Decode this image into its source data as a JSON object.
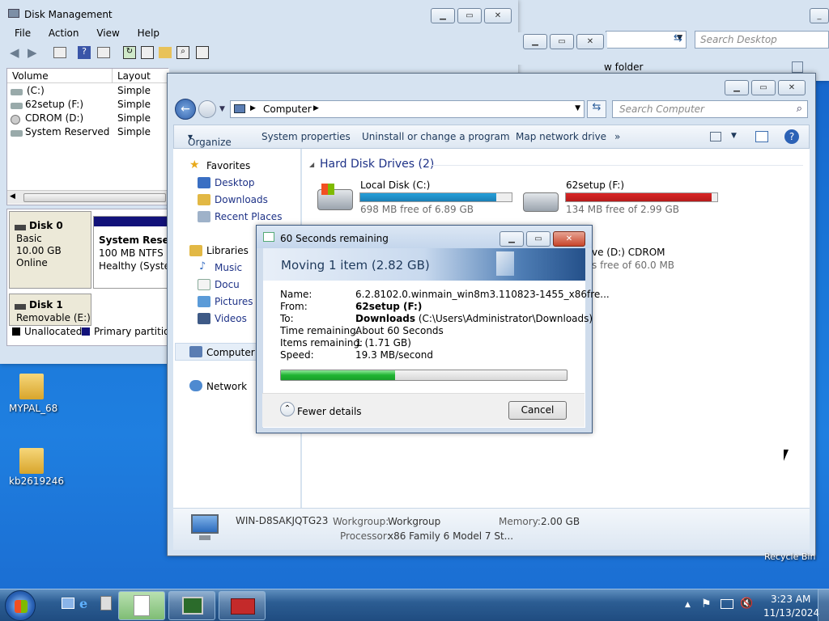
{
  "disk_mgmt": {
    "title": "Disk Management",
    "menu": [
      "File",
      "Action",
      "View",
      "Help"
    ],
    "col_volume": "Volume",
    "col_layout": "Layout",
    "volumes": [
      {
        "name": "(C:)",
        "layout": "Simple"
      },
      {
        "name": "62setup (F:)",
        "layout": "Simple"
      },
      {
        "name": "CDROM (D:)",
        "layout": "Simple"
      },
      {
        "name": "System Reserved",
        "layout": "Simple"
      }
    ],
    "disk0": {
      "name": "Disk 0",
      "type": "Basic",
      "size": "10.00 GB",
      "status": "Online"
    },
    "sysres": {
      "name": "System Reserv",
      "size": "100 MB NTFS",
      "status": "Healthy (System"
    },
    "disk1": {
      "name": "Disk 1",
      "type": "Removable (E:)"
    },
    "legend": {
      "unallocated": "Unallocated",
      "primary": "Primary partition"
    }
  },
  "bg_explorer": {
    "search_placeholder": "Search Desktop",
    "new_folder": "w folder"
  },
  "explorer": {
    "breadcrumb": "Computer",
    "search_placeholder": "Search Computer",
    "toolbar": {
      "organize": "Organize",
      "system_properties": "System properties",
      "uninstall": "Uninstall or change a program",
      "map_drive": "Map network drive",
      "more": "»"
    },
    "nav": {
      "favorites": "Favorites",
      "desktop": "Desktop",
      "downloads": "Downloads",
      "recent": "Recent Places",
      "libraries": "Libraries",
      "music": "Music",
      "documents": "Docu",
      "pictures": "Pictures",
      "videos": "Videos",
      "computer": "Computer",
      "network": "Network"
    },
    "group_title": "Hard Disk Drives (2)",
    "drives": [
      {
        "name": "Local Disk (C:)",
        "free": "698 MB free of 6.89 GB",
        "fill": 0.9,
        "color": "#26a0da"
      },
      {
        "name": "62setup (F:)",
        "free": "134 MB free of 2.99 GB",
        "fill": 0.96,
        "color": "#da2626"
      }
    ],
    "cdrom": {
      "name": "ve (D:) CDROM",
      "free": "s free of 60.0 MB"
    },
    "details": {
      "machine": "WIN-D8SAKJQTG23",
      "workgroup_label": "Workgroup:",
      "workgroup": "Workgroup",
      "memory_label": "Memory:",
      "memory": "2.00 GB",
      "processor_label": "Processor:",
      "processor": "x86 Family 6 Model 7 St..."
    }
  },
  "dialog": {
    "title": "60 Seconds remaining",
    "heading": "Moving 1 item (2.82 GB)",
    "name_label": "Name:",
    "name": "6.2.8102.0.winmain_win8m3.110823-1455_x86fre...",
    "from_label": "From:",
    "from": "62setup (F:)",
    "to_label": "To:",
    "to_bold": "Downloads",
    "to_rest": "(C:\\Users\\Administrator\\Downloads)",
    "time_label": "Time remaining:",
    "time": "About 60 Seconds",
    "items_label": "Items remaining:",
    "items": "1 (1.71 GB)",
    "speed_label": "Speed:",
    "speed": "19.3 MB/second",
    "progress": 0.4,
    "fewer": "Fewer details",
    "cancel": "Cancel"
  },
  "desktop": {
    "icon1": "MYPAL_68",
    "icon2": "kb2619246",
    "recycle": "Recycle Bin"
  },
  "taskbar": {
    "time": "3:23 AM",
    "date": "11/13/2024"
  }
}
